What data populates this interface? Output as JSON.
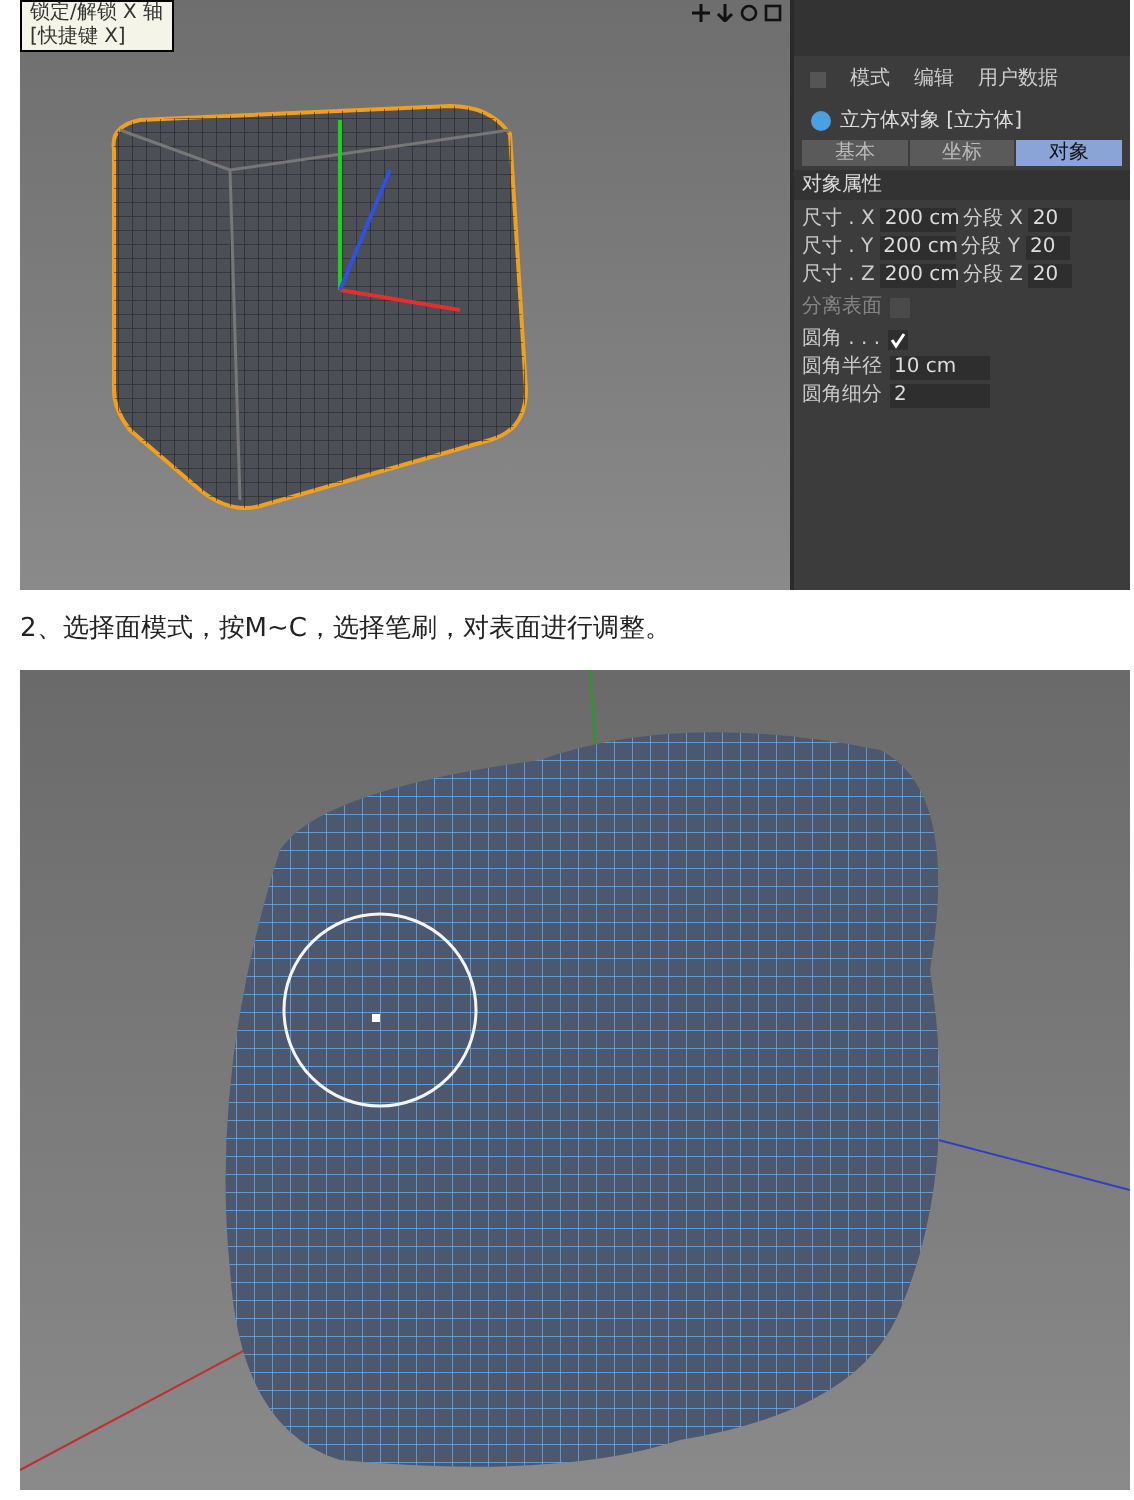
{
  "screenshot_1": {
    "tooltip": [
      "锁定/解锁 X 轴",
      "[快捷键 X]"
    ],
    "attributes": {
      "menu": [
        "模式",
        "编辑",
        "用户数据"
      ],
      "object_title": "立方体对象 [立方体]",
      "tabs": [
        {
          "label": "基本",
          "selected": false
        },
        {
          "label": "坐标",
          "selected": false
        },
        {
          "label": "对象",
          "selected": true
        }
      ],
      "section": "对象属性",
      "size_rows": [
        {
          "label": "尺寸 . X",
          "value": "200 cm",
          "seg_label": "分段 X",
          "seg_value": "20"
        },
        {
          "label": "尺寸 . Y",
          "value": "200 cm",
          "seg_label": "分段 Y",
          "seg_value": "20"
        },
        {
          "label": "尺寸 . Z",
          "value": "200 cm",
          "seg_label": "分段 Z",
          "seg_value": "20"
        }
      ],
      "separate_surfaces": {
        "label": "分离表面",
        "checked": false,
        "disabled": true
      },
      "fillet": {
        "label": "圆角 . . .",
        "checked": true
      },
      "fillet_rows": [
        {
          "label": "圆角半径",
          "value": "10 cm"
        },
        {
          "label": "圆角细分",
          "value": "2"
        }
      ]
    }
  },
  "caption": "2、选择面模式，按M~C，选择笔刷，对表面进行调整。"
}
